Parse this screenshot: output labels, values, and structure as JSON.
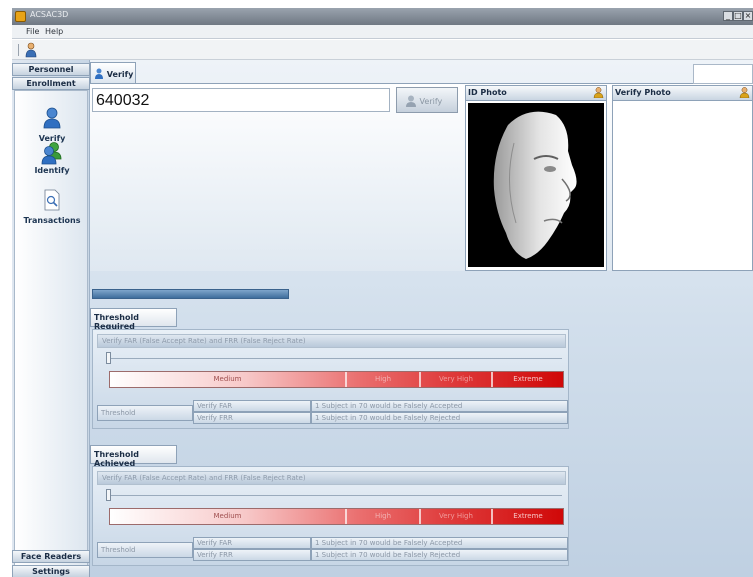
{
  "window": {
    "title": "ACSAC3D",
    "buttons": [
      "_",
      "□",
      "×"
    ]
  },
  "menu": [
    "File",
    "Help"
  ],
  "sidebar": {
    "top_headers": [
      "Personnel",
      "Enrollment Station"
    ],
    "items": [
      {
        "label": "Verify",
        "icon": "person-icon"
      },
      {
        "label": "Identify",
        "icon": "users-icon"
      },
      {
        "label": "Transactions",
        "icon": "document-search-icon"
      }
    ],
    "bottom_headers": [
      "Face Readers",
      "Settings"
    ]
  },
  "main": {
    "tab_label": "Verify",
    "id_value": "640032",
    "verify_button": "Verify",
    "id_photo_label": "ID Photo",
    "verify_photo_label": "Verify Photo",
    "progress_fraction": 0.3
  },
  "threshold_required": {
    "tab_label": "Threshold Required",
    "slider_label": "Verify FAR (False Accept Rate) and FRR (False Reject Rate)",
    "slider_position": 0.0,
    "scale": [
      "Medium",
      "High",
      "Very High",
      "Extreme"
    ],
    "row_label": "Threshold",
    "rows": [
      {
        "name": "Verify FAR",
        "desc": "1 Subject in 70 would be Falsely Accepted"
      },
      {
        "name": "Verify FRR",
        "desc": "1 Subject in 70 would be Falsely Rejected"
      }
    ]
  },
  "threshold_achieved": {
    "tab_label": "Threshold Achieved",
    "slider_label": "Verify FAR (False Accept Rate) and FRR (False Reject Rate)",
    "slider_position": 0.0,
    "scale": [
      "Medium",
      "High",
      "Very High",
      "Extreme"
    ],
    "row_label": "Threshold",
    "rows": [
      {
        "name": "Verify FAR",
        "desc": "1 Subject in 70 would be Falsely Accepted"
      },
      {
        "name": "Verify FRR",
        "desc": "1 Subject in 70 would be Falsely Rejected"
      }
    ]
  },
  "colors": {
    "accent": "#3f6d9c",
    "scale_low": "#ffffff",
    "scale_high": "#d00808"
  }
}
